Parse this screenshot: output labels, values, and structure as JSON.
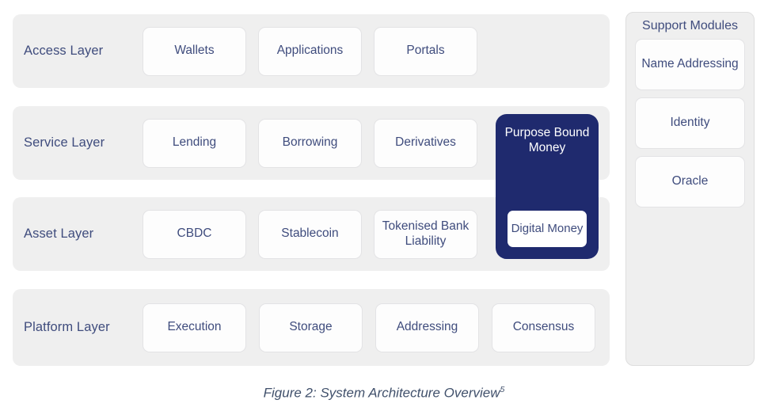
{
  "figure": {
    "caption_text": "Figure 2: System Architecture Overview",
    "caption_superscript": "5"
  },
  "colors": {
    "canvas": "#ffffff",
    "row_background": "#efefef",
    "card_background": "#fdfdfd",
    "card_border": "#e3e3e5",
    "text_primary": "#3f4c7d",
    "highlight_navy": "#1f2a6e",
    "highlight_text": "#ffffff",
    "caption_text": "#40506b"
  },
  "layers": [
    {
      "label": "Access Layer",
      "cards": [
        {
          "label": "Wallets"
        },
        {
          "label": "Applications"
        },
        {
          "label": "Portals"
        }
      ]
    },
    {
      "label": "Service Layer",
      "cards": [
        {
          "label": "Lending"
        },
        {
          "label": "Borrowing"
        },
        {
          "label": "Derivatives"
        }
      ]
    },
    {
      "label": "Asset Layer",
      "cards": [
        {
          "label": "CBDC"
        },
        {
          "label": "Stablecoin"
        },
        {
          "label": "Tokenised Bank Liability"
        }
      ]
    },
    {
      "label": "Platform Layer",
      "cards": [
        {
          "label": "Execution"
        },
        {
          "label": "Storage"
        },
        {
          "label": "Addressing"
        },
        {
          "label": "Consensus"
        }
      ]
    }
  ],
  "highlight": {
    "title": "Purpose Bound Money",
    "inner_label": "Digital Money"
  },
  "support_modules": {
    "title": "Support Modules",
    "items": [
      {
        "label": "Name Addressing"
      },
      {
        "label": "Identity"
      },
      {
        "label": "Oracle"
      }
    ]
  }
}
